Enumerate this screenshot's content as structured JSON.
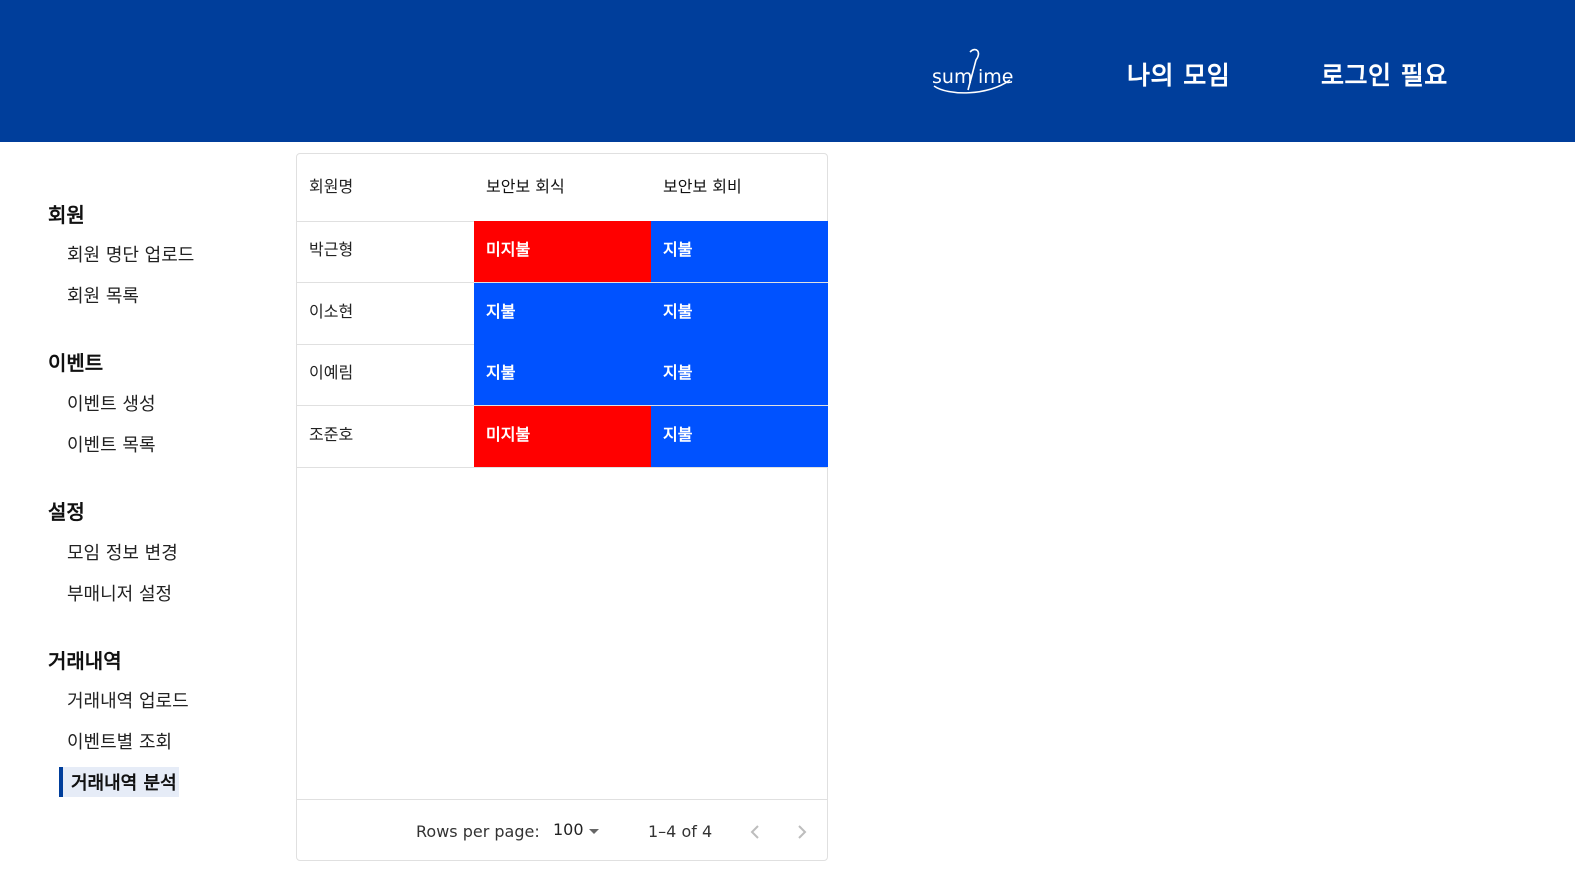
{
  "header": {
    "logo_text": "sumtime",
    "nav": [
      {
        "label": "나의 모임"
      },
      {
        "label": "로그인 필요"
      }
    ]
  },
  "sidebar": {
    "sections": [
      {
        "title": "회원",
        "items": [
          {
            "label": "회원 명단 업로드"
          },
          {
            "label": "회원 목록"
          }
        ]
      },
      {
        "title": "이벤트",
        "items": [
          {
            "label": "이벤트 생성"
          },
          {
            "label": "이벤트 목록"
          }
        ]
      },
      {
        "title": "설정",
        "items": [
          {
            "label": "모임 정보 변경"
          },
          {
            "label": "부매니저 설정"
          }
        ]
      },
      {
        "title": "거래내역",
        "items": [
          {
            "label": "거래내역 업로드"
          },
          {
            "label": "이벤트별 조회"
          },
          {
            "label": "거래내역 분석",
            "active": true
          }
        ]
      }
    ]
  },
  "table": {
    "columns": [
      "회원명",
      "보안보 회식",
      "보안보 회비"
    ],
    "rows": [
      {
        "name": "박근형",
        "values": [
          "미지불",
          "지불"
        ]
      },
      {
        "name": "이소현",
        "values": [
          "지불",
          "지불"
        ]
      },
      {
        "name": "이예림",
        "values": [
          "지불",
          "지불"
        ]
      },
      {
        "name": "조준호",
        "values": [
          "미지불",
          "지불"
        ]
      }
    ],
    "footer": {
      "rows_per_page_label": "Rows per page:",
      "rows_per_page_value": "100",
      "range_text": "1–4 of 4"
    }
  },
  "colors": {
    "header_bg": "#003e9b",
    "paid": "#0052ff",
    "unpaid": "#ff0000"
  }
}
